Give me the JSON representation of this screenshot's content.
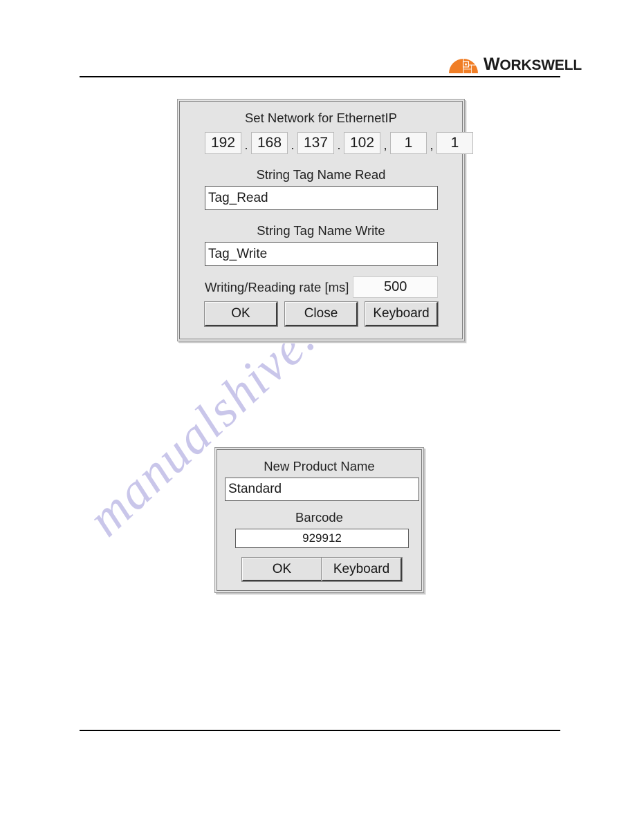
{
  "header": {
    "logo_icon": "workswell-dome-icon",
    "brand_name": "WORKSWELL",
    "brand_initial": "W",
    "brand_rest": "ORKSWELL",
    "brand_color": "#F07E26"
  },
  "watermark": {
    "text": "manualshive.com",
    "color": "#c9c6ea"
  },
  "dialog_ethernetip": {
    "title": "Set Network for EthernetIP",
    "ip_octets": [
      {
        "value": "192",
        "separator": "."
      },
      {
        "value": "168",
        "separator": "."
      },
      {
        "value": "137",
        "separator": "."
      },
      {
        "value": "102",
        "separator": ","
      },
      {
        "value": "1",
        "separator": ","
      },
      {
        "value": "1",
        "separator": ""
      }
    ],
    "read_label": "String Tag Name Read",
    "read_value": "Tag_Read",
    "write_label": "String Tag Name Write",
    "write_value": "Tag_Write",
    "rate_label": "Writing/Reading rate [ms]",
    "rate_value": "500",
    "buttons": {
      "ok": "OK",
      "close": "Close",
      "keyboard": "Keyboard"
    }
  },
  "dialog_new_product": {
    "name_label": "New Product Name",
    "name_value": "Standard",
    "barcode_label": "Barcode",
    "barcode_value": "929912",
    "buttons": {
      "ok": "OK",
      "keyboard": "Keyboard"
    }
  }
}
